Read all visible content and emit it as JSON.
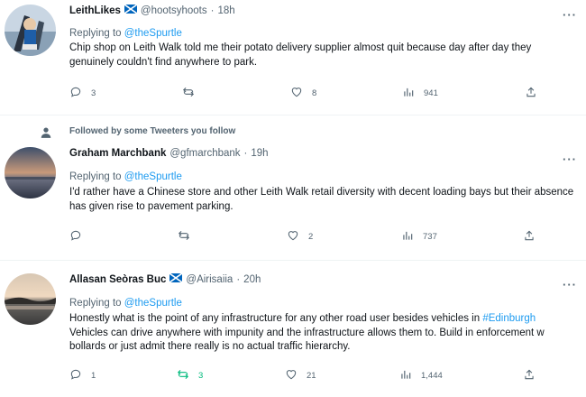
{
  "tweets": [
    {
      "name": "LeithLikes",
      "handle": "@hootsyhoots",
      "time": "18h",
      "reply_prefix": "Replying to",
      "reply_to": "@theSpurtle",
      "text": "Chip shop on Leith Walk told me their potato delivery supplier almost quit because day after day they genuinely couldn't find anywhere to park.",
      "replies": "3",
      "retweets": "",
      "likes": "8",
      "views": "941"
    },
    {
      "social_context": "Followed by some Tweeters you follow",
      "name": "Graham Marchbank",
      "handle": "@gfmarchbank",
      "time": "19h",
      "reply_prefix": "Replying to",
      "reply_to": "@theSpurtle",
      "text": "I'd rather have a Chinese store and other Leith Walk retail diversity with decent loading bays but their absence has given rise to pavement parking.",
      "replies": "",
      "retweets": "",
      "likes": "2",
      "views": "737"
    },
    {
      "name": "Allasan Seòras Buc",
      "handle": "@Airisaiia",
      "time": "20h",
      "reply_prefix": "Replying to",
      "reply_to": "@theSpurtle",
      "text_before": "Honestly what is the point of any infrastructure for any other road user besides vehicles in ",
      "hashtag": "#Edinburgh",
      "text_after": " Vehicles can drive anywhere with impunity and the infrastructure allows them to. Build in enforcement w bollards or just admit there really is no actual traffic hierarchy.",
      "replies": "1",
      "retweets": "3",
      "likes": "21",
      "views": "1,444"
    }
  ],
  "more_label": "···",
  "colors": {
    "accent": "#1d9bf0",
    "muted": "#536471",
    "retweet_green": "#00ba7c",
    "divider": "#eff3f4"
  },
  "icons": [
    "reply-icon",
    "retweet-icon",
    "like-icon",
    "views-icon",
    "share-icon",
    "more-icon",
    "person-icon",
    "scotland-flag-icon"
  ]
}
